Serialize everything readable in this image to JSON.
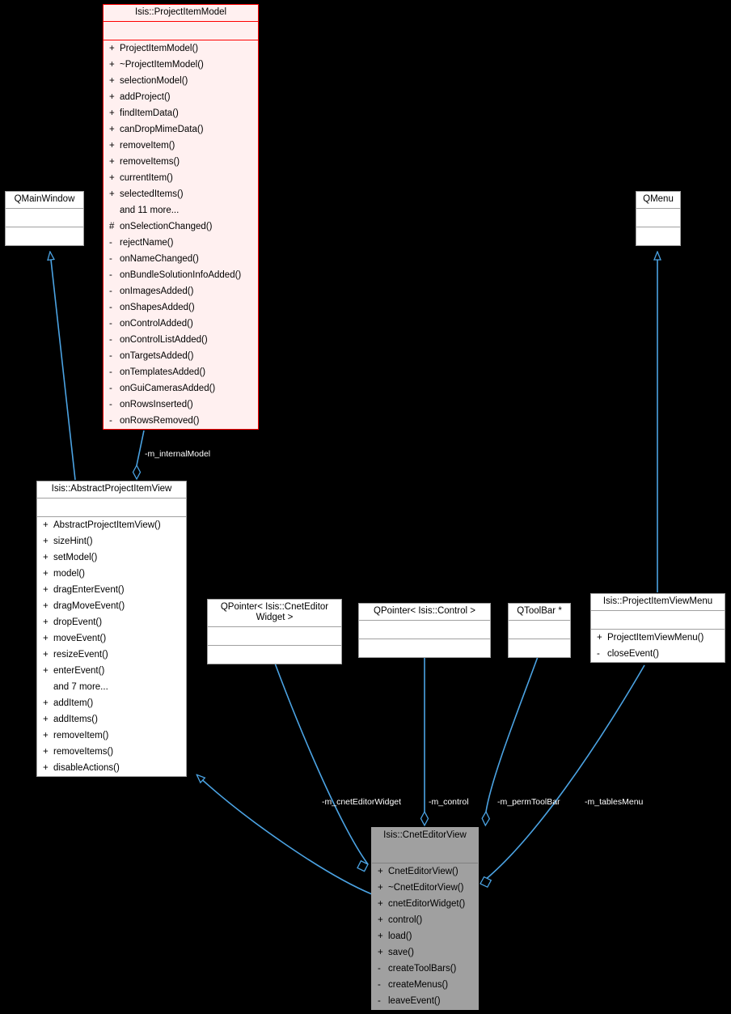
{
  "diagram": {
    "title": "Isis::CnetEditorView class collaboration diagram",
    "background": "#000000",
    "edge_color": "#4BA3E3",
    "root_border_color": "#FF0000",
    "root_fill_color": "#FFF0F0",
    "current_fill_color": "#808080"
  },
  "nodes": {
    "project_item_model": {
      "title": "Isis::ProjectItemModel",
      "attributes": [],
      "operations": [
        {
          "vis": "+",
          "name": "ProjectItemModel()"
        },
        {
          "vis": "+",
          "name": "~ProjectItemModel()"
        },
        {
          "vis": "+",
          "name": "selectionModel()"
        },
        {
          "vis": "+",
          "name": "addProject()"
        },
        {
          "vis": "+",
          "name": "findItemData()"
        },
        {
          "vis": "+",
          "name": "canDropMimeData()"
        },
        {
          "vis": "+",
          "name": "removeItem()"
        },
        {
          "vis": "+",
          "name": "removeItems()"
        },
        {
          "vis": "+",
          "name": "currentItem()"
        },
        {
          "vis": "+",
          "name": "selectedItems()"
        },
        {
          "vis": "",
          "name": "and 11 more..."
        },
        {
          "vis": "#",
          "name": "onSelectionChanged()"
        },
        {
          "vis": "-",
          "name": "rejectName()"
        },
        {
          "vis": "-",
          "name": "onNameChanged()"
        },
        {
          "vis": "-",
          "name": "onBundleSolutionInfoAdded()"
        },
        {
          "vis": "-",
          "name": "onImagesAdded()"
        },
        {
          "vis": "-",
          "name": "onShapesAdded()"
        },
        {
          "vis": "-",
          "name": "onControlAdded()"
        },
        {
          "vis": "-",
          "name": "onControlListAdded()"
        },
        {
          "vis": "-",
          "name": "onTargetsAdded()"
        },
        {
          "vis": "-",
          "name": "onTemplatesAdded()"
        },
        {
          "vis": "-",
          "name": "onGuiCamerasAdded()"
        },
        {
          "vis": "-",
          "name": "onRowsInserted()"
        },
        {
          "vis": "-",
          "name": "onRowsRemoved()"
        }
      ]
    },
    "qmainwindow": {
      "title": "QMainWindow",
      "attributes": [],
      "operations": []
    },
    "qmenu": {
      "title": "QMenu",
      "attributes": [],
      "operations": []
    },
    "abstract_project_item_view": {
      "title": "Isis::AbstractProjectItemView",
      "attributes": [],
      "operations": [
        {
          "vis": "+",
          "name": "AbstractProjectItemView()"
        },
        {
          "vis": "+",
          "name": "sizeHint()"
        },
        {
          "vis": "+",
          "name": "setModel()"
        },
        {
          "vis": "+",
          "name": "model()"
        },
        {
          "vis": "+",
          "name": "dragEnterEvent()"
        },
        {
          "vis": "+",
          "name": "dragMoveEvent()"
        },
        {
          "vis": "+",
          "name": "dropEvent()"
        },
        {
          "vis": "+",
          "name": "moveEvent()"
        },
        {
          "vis": "+",
          "name": "resizeEvent()"
        },
        {
          "vis": "+",
          "name": "enterEvent()"
        },
        {
          "vis": "",
          "name": "and 7 more..."
        },
        {
          "vis": "+",
          "name": "addItem()"
        },
        {
          "vis": "+",
          "name": "addItems()"
        },
        {
          "vis": "+",
          "name": "removeItem()"
        },
        {
          "vis": "+",
          "name": "removeItems()"
        },
        {
          "vis": "+",
          "name": "disableActions()"
        }
      ]
    },
    "qpointer_cneteditorwidget": {
      "title": "QPointer< Isis::CnetEditor\nWidget >",
      "attributes": [],
      "operations": []
    },
    "qpointer_control": {
      "title": "QPointer< Isis::Control >",
      "attributes": [],
      "operations": []
    },
    "qtoolbar": {
      "title": "QToolBar *",
      "attributes": [],
      "operations": []
    },
    "project_item_view_menu": {
      "title": "Isis::ProjectItemViewMenu",
      "attributes": [],
      "operations": [
        {
          "vis": "+",
          "name": "ProjectItemViewMenu()"
        },
        {
          "vis": "-",
          "name": "closeEvent()"
        }
      ]
    },
    "cnet_editor_view": {
      "title": "Isis::CnetEditorView",
      "attributes": [],
      "operations": [
        {
          "vis": "+",
          "name": "CnetEditorView()"
        },
        {
          "vis": "+",
          "name": "~CnetEditorView()"
        },
        {
          "vis": "+",
          "name": "cnetEditorWidget()"
        },
        {
          "vis": "+",
          "name": "control()"
        },
        {
          "vis": "+",
          "name": "load()"
        },
        {
          "vis": "+",
          "name": "save()"
        },
        {
          "vis": "-",
          "name": "createToolBars()"
        },
        {
          "vis": "-",
          "name": "createMenus()"
        },
        {
          "vis": "-",
          "name": "leaveEvent()"
        }
      ]
    }
  },
  "edge_labels": {
    "internal_model": "-m_internalModel",
    "cnet_editor_widget": "-m_cnetEditorWidget",
    "control": "-m_control",
    "perm_toolbar": "-m_permToolBar",
    "tables_menu": "-m_tablesMenu"
  }
}
